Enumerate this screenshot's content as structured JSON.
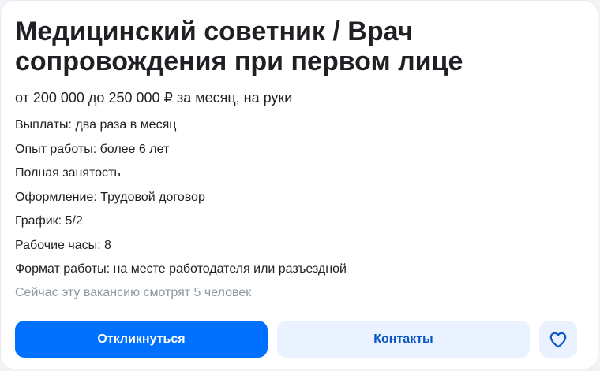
{
  "vacancy": {
    "title": "Медицинский советник / Врач сопровождения при первом лице",
    "salary": "от 200 000 до 250 000 ₽ за месяц, на руки",
    "details": [
      "Выплаты: два раза в месяц",
      "Опыт работы: более 6 лет",
      "Полная занятость",
      "Оформление: Трудовой договор",
      "График: 5/2",
      "Рабочие часы: 8",
      "Формат работы: на месте работодателя или разъездной"
    ],
    "viewers": "Сейчас эту вакансию смотрят 5 человек"
  },
  "actions": {
    "respond_label": "Откликнуться",
    "contacts_label": "Контакты",
    "favorite_icon": "heart-icon"
  },
  "colors": {
    "primary": "#0070ff",
    "secondary_bg": "#e9f2fe",
    "secondary_text": "#0a56c2",
    "muted_text": "#8f98a3"
  }
}
